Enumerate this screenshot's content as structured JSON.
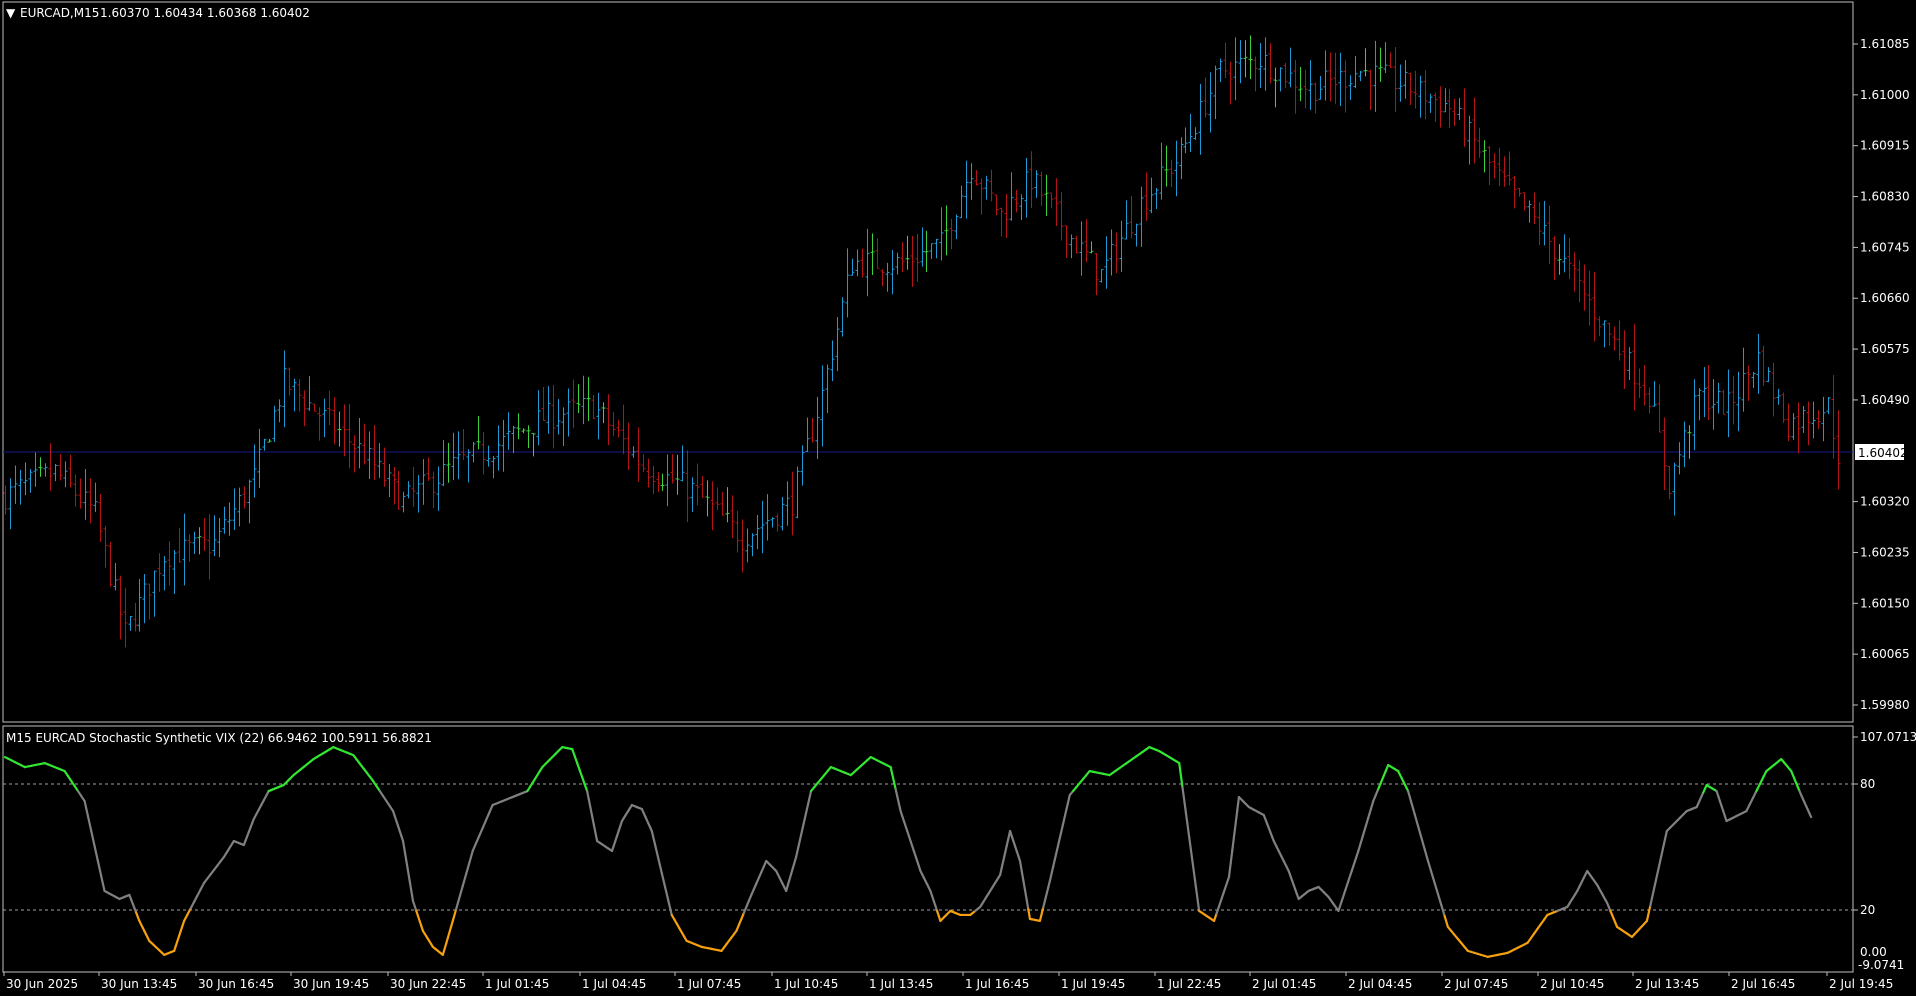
{
  "main_panel": {
    "header": {
      "symbol_timeframe": "EURCAD,M15",
      "ohlc": "1.60370 1.60434 1.60368 1.60402"
    },
    "current_price_label": "1.60402",
    "price_axis_labels": [
      "1.61085",
      "1.61000",
      "1.60915",
      "1.60830",
      "1.60745",
      "1.60660",
      "1.60575",
      "1.60490",
      "1.60402",
      "1.60320",
      "1.60235",
      "1.60150",
      "1.60065",
      "1.59980"
    ]
  },
  "indicator_panel": {
    "header": "M15 EURCAD Stochastic  Synthetic VIX (22) 66.9462 100.5911 56.8821",
    "axis_labels": [
      "107.0713",
      "80",
      "20",
      "0.00",
      "-9.0741"
    ]
  },
  "time_axis_labels": [
    "30 Jun 2025",
    "30 Jun 13:45",
    "30 Jun 16:45",
    "30 Jun 19:45",
    "30 Jun 22:45",
    "1 Jul 01:45",
    "1 Jul 04:45",
    "1 Jul 07:45",
    "1 Jul 10:45",
    "1 Jul 13:45",
    "1 Jul 16:45",
    "1 Jul 19:45",
    "1 Jul 22:45",
    "2 Jul 01:45",
    "2 Jul 04:45",
    "2 Jul 07:45",
    "2 Jul 10:45",
    "2 Jul 13:45",
    "2 Jul 16:45",
    "2 Jul 19:45"
  ],
  "colors": {
    "background": "#000000",
    "border": "#c0c0c0",
    "bull_bar": "#1e9bd7",
    "bear_bar": "#b41414",
    "neutral_bar": "#3cd23c",
    "current_price_line": "#1a1a8c",
    "vix_high": "#32e632",
    "vix_mid": "#808080",
    "vix_low": "#f5a00f",
    "level_line": "#a0a0a0"
  },
  "chart_data": [
    {
      "type": "ohlc",
      "symbol": "EURCAD",
      "timeframe": "M15",
      "ylim": [
        1.5995,
        1.6115
      ],
      "y_ticks": [
        1.61085,
        1.61,
        1.60915,
        1.6083,
        1.60745,
        1.6066,
        1.60575,
        1.6049,
        1.60402,
        1.6032,
        1.60235,
        1.6015,
        1.60065,
        1.5998
      ],
      "current_price": 1.60402,
      "close_path_anchors": [
        [
          0,
          1.6033
        ],
        [
          10,
          1.6037
        ],
        [
          18,
          1.603
        ],
        [
          24,
          1.601
        ],
        [
          32,
          1.6023
        ],
        [
          42,
          1.6025
        ],
        [
          50,
          1.6036
        ],
        [
          56,
          1.6052
        ],
        [
          64,
          1.6046
        ],
        [
          72,
          1.604
        ],
        [
          80,
          1.6032
        ],
        [
          90,
          1.6038
        ],
        [
          100,
          1.6042
        ],
        [
          108,
          1.6046
        ],
        [
          118,
          1.6048
        ],
        [
          128,
          1.6038
        ],
        [
          138,
          1.6034
        ],
        [
          148,
          1.6026
        ],
        [
          158,
          1.6032
        ],
        [
          164,
          1.605
        ],
        [
          170,
          1.6072
        ],
        [
          180,
          1.6072
        ],
        [
          188,
          1.6075
        ],
        [
          194,
          1.6088
        ],
        [
          200,
          1.608
        ],
        [
          206,
          1.6086
        ],
        [
          214,
          1.6076
        ],
        [
          220,
          1.607
        ],
        [
          228,
          1.6082
        ],
        [
          236,
          1.609
        ],
        [
          244,
          1.6104
        ],
        [
          252,
          1.6106
        ],
        [
          262,
          1.6101
        ],
        [
          272,
          1.6104
        ],
        [
          280,
          1.6102
        ],
        [
          290,
          1.6098
        ],
        [
          300,
          1.6086
        ],
        [
          308,
          1.6078
        ],
        [
          316,
          1.6068
        ],
        [
          322,
          1.606
        ],
        [
          330,
          1.605
        ],
        [
          334,
          1.6035
        ],
        [
          340,
          1.605
        ],
        [
          346,
          1.6048
        ],
        [
          352,
          1.6056
        ],
        [
          358,
          1.6045
        ],
        [
          366,
          1.6048
        ],
        [
          368,
          1.604
        ]
      ],
      "bars": 369
    },
    {
      "type": "line",
      "name": "Stochastic  Synthetic VIX (22)",
      "ylim": [
        -9.0741,
        107.0713
      ],
      "levels": [
        80,
        20
      ],
      "thresholds": {
        "high": 80,
        "low": 20
      },
      "x_index_max": 368,
      "points": [
        [
          0,
          97
        ],
        [
          4,
          92
        ],
        [
          8,
          94
        ],
        [
          12,
          90
        ],
        [
          16,
          75
        ],
        [
          20,
          30
        ],
        [
          23,
          26
        ],
        [
          25,
          28
        ],
        [
          27,
          15
        ],
        [
          29,
          5
        ],
        [
          32,
          -2
        ],
        [
          34,
          0
        ],
        [
          36,
          15
        ],
        [
          40,
          34
        ],
        [
          44,
          47
        ],
        [
          46,
          55
        ],
        [
          48,
          53
        ],
        [
          50,
          66
        ],
        [
          53,
          80
        ],
        [
          56,
          83
        ],
        [
          58,
          88
        ],
        [
          62,
          96
        ],
        [
          66,
          102
        ],
        [
          70,
          98
        ],
        [
          74,
          85
        ],
        [
          78,
          70
        ],
        [
          80,
          55
        ],
        [
          82,
          25
        ],
        [
          84,
          10
        ],
        [
          86,
          2
        ],
        [
          88,
          -2
        ],
        [
          90,
          15
        ],
        [
          94,
          50
        ],
        [
          98,
          73
        ],
        [
          102,
          77
        ],
        [
          105,
          80
        ],
        [
          108,
          92
        ],
        [
          112,
          102
        ],
        [
          114,
          101
        ],
        [
          117,
          80
        ],
        [
          119,
          55
        ],
        [
          122,
          50
        ],
        [
          124,
          65
        ],
        [
          126,
          73
        ],
        [
          128,
          71
        ],
        [
          130,
          60
        ],
        [
          134,
          18
        ],
        [
          137,
          5
        ],
        [
          140,
          2
        ],
        [
          144,
          0
        ],
        [
          147,
          10
        ],
        [
          150,
          28
        ],
        [
          153,
          45
        ],
        [
          155,
          40
        ],
        [
          157,
          30
        ],
        [
          159,
          47
        ],
        [
          162,
          80
        ],
        [
          166,
          92
        ],
        [
          170,
          88
        ],
        [
          174,
          97
        ],
        [
          178,
          92
        ],
        [
          180,
          70
        ],
        [
          184,
          40
        ],
        [
          186,
          30
        ],
        [
          188,
          15
        ],
        [
          190,
          20
        ],
        [
          192,
          18
        ],
        [
          194,
          18
        ],
        [
          196,
          22
        ],
        [
          198,
          30
        ],
        [
          200,
          38
        ],
        [
          202,
          60
        ],
        [
          204,
          45
        ],
        [
          206,
          16
        ],
        [
          208,
          15
        ],
        [
          210,
          35
        ],
        [
          214,
          78
        ],
        [
          218,
          90
        ],
        [
          222,
          88
        ],
        [
          226,
          95
        ],
        [
          230,
          102
        ],
        [
          232,
          100
        ],
        [
          236,
          94
        ],
        [
          240,
          20
        ],
        [
          243,
          15
        ],
        [
          246,
          37
        ],
        [
          248,
          77
        ],
        [
          250,
          72
        ],
        [
          253,
          68
        ],
        [
          255,
          55
        ],
        [
          258,
          40
        ],
        [
          260,
          26
        ],
        [
          262,
          30
        ],
        [
          264,
          32
        ],
        [
          266,
          27
        ],
        [
          268,
          20
        ],
        [
          272,
          50
        ],
        [
          275,
          75
        ],
        [
          278,
          93
        ],
        [
          280,
          90
        ],
        [
          282,
          80
        ],
        [
          286,
          45
        ],
        [
          290,
          12
        ],
        [
          294,
          0
        ],
        [
          298,
          -3
        ],
        [
          302,
          -1
        ],
        [
          306,
          4
        ],
        [
          310,
          18
        ],
        [
          312,
          20
        ],
        [
          314,
          22
        ],
        [
          316,
          30
        ],
        [
          318,
          40
        ],
        [
          320,
          33
        ],
        [
          322,
          24
        ],
        [
          324,
          12
        ],
        [
          327,
          7
        ],
        [
          330,
          15
        ],
        [
          334,
          60
        ],
        [
          338,
          70
        ],
        [
          340,
          72
        ],
        [
          342,
          83
        ],
        [
          344,
          80
        ],
        [
          346,
          65
        ],
        [
          350,
          70
        ],
        [
          354,
          90
        ],
        [
          357,
          96
        ],
        [
          359,
          90
        ],
        [
          361,
          78
        ],
        [
          363,
          67
        ]
      ]
    }
  ]
}
